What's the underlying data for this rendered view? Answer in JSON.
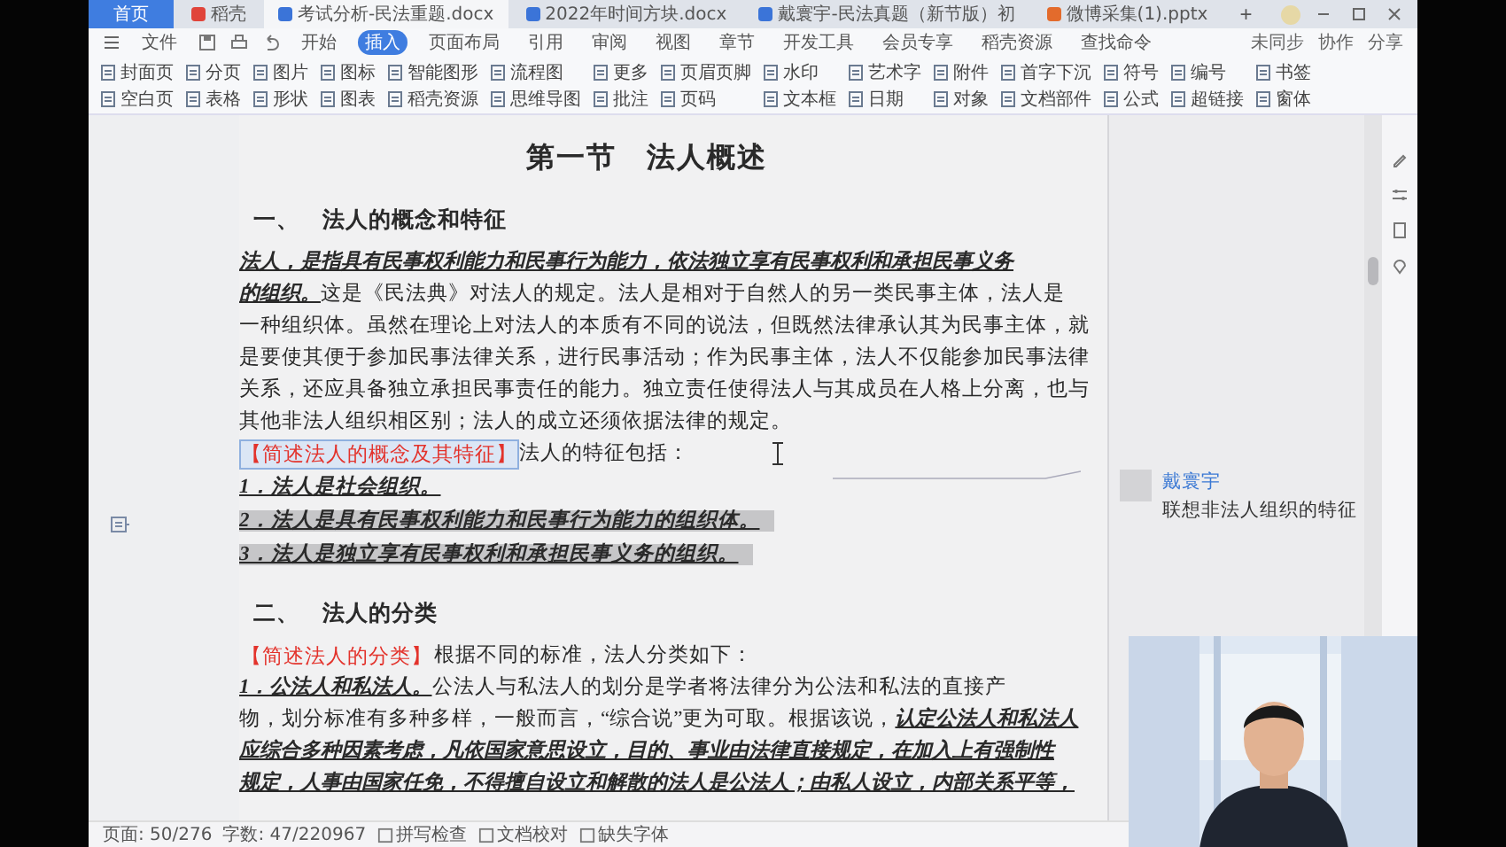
{
  "tabs": [
    {
      "label": "首页",
      "kind": "home",
      "selected": false
    },
    {
      "label": "稻壳",
      "kind": "docer",
      "selected": false
    },
    {
      "label": "考试分析-民法重题.docx",
      "kind": "word",
      "selected": true
    },
    {
      "label": "2022年时间方块.docx",
      "kind": "word",
      "selected": false
    },
    {
      "label": "戴寰宇-民法真题（新节版）初",
      "kind": "word",
      "selected": false
    },
    {
      "label": "微博采集(1).pptx",
      "kind": "ppt",
      "selected": false
    }
  ],
  "new_tab": "+",
  "menu": [
    {
      "label": "文件",
      "selected": false
    },
    {
      "label": "开始",
      "selected": false
    },
    {
      "label": "插入",
      "selected": true
    },
    {
      "label": "页面布局",
      "selected": false
    },
    {
      "label": "引用",
      "selected": false
    },
    {
      "label": "审阅",
      "selected": false
    },
    {
      "label": "视图",
      "selected": false
    },
    {
      "label": "章节",
      "selected": false
    },
    {
      "label": "开发工具",
      "selected": false
    },
    {
      "label": "会员专享",
      "selected": false
    },
    {
      "label": "稻壳资源",
      "selected": false
    },
    {
      "label": "查找命令",
      "selected": false
    }
  ],
  "share": [
    "未同步",
    "协作",
    "分享"
  ],
  "ribbon": [
    "封面页",
    "空白页",
    "分页",
    "表格",
    "图片",
    "形状",
    "图标",
    "图表",
    "智能图形",
    "稻壳资源",
    "流程图",
    "思维导图",
    "更多",
    "批注",
    "页眉页脚",
    "页码",
    "水印",
    "文本框",
    "艺术字",
    "日期",
    "附件",
    "对象",
    "首字下沉",
    "文档部件",
    "符号",
    "公式",
    "编号",
    "超链接",
    "书签",
    "窗体"
  ],
  "doc": {
    "title": "第一节　法人概述",
    "blocks": [
      {
        "kind": "heading",
        "text": "一、　法人的概念和特征"
      },
      {
        "kind": "paragraph",
        "lines": [
          "**法人，是指具有民事权利能力和民事行为能力，依法独立享有民事权利和承担民事义务**",
          "**的组织。**这是《民法典》对法人的规定。法人是相对于自然人的另一类民事主体，法人是",
          "一种组织体。虽然在理论上对法人的本质有不同的说法，但既然法律承认其为民事主体，就",
          "是要使其便于参加民事法律关系，进行民事活动；作为民事主体，法人不仅能参加民事法律",
          "关系，还应具备独立承担民事责任的能力。独立责任使得法人与其成员在人格上分离，也与",
          "其他非法人组织相区别；法人的成立还须依据法律的规定。"
        ]
      },
      {
        "kind": "labeled",
        "label": {
          "text": "【简述法人的概念及其特征】",
          "selected": true
        },
        "text": "法人的特征包括："
      },
      {
        "kind": "list",
        "items": [
          {
            "text": "1．法人是社会组织。",
            "highlighted": false
          },
          {
            "text": "2．法人是具有民事权利能力和民事行为能力的组织体。",
            "highlighted": true
          },
          {
            "text": "3．法人是独立享有民事权利和承担民事义务的组织。",
            "highlighted": true
          }
        ]
      },
      {
        "kind": "heading",
        "text": "二、　法人的分类"
      },
      {
        "kind": "labeled",
        "label": {
          "text": "【简述法人的分类】",
          "selected": false
        },
        "text": "根据不同的标准，法人分类如下："
      },
      {
        "kind": "paragraph",
        "lines": [
          "**1．公法人和私法人。**公法人与私法人的划分是学者将法律分为公法和私法的直接产",
          "物，划分标准有多种多样，一般而言，“综合说”更为可取。根据该说，**认定公法人和私法人**",
          "**应综合多种因素考虑，凡依国家意思设立，目的、事业由法律直接规定，在加入上有强制性**",
          "**规定，人事由国家任免，不得擅自设立和解散的法人是公法人；由私人设立，内部关系平等，**"
        ]
      }
    ]
  },
  "comment": {
    "author": "戴寰宇",
    "text": "联想非法人组织的特征"
  },
  "status_bar": [
    "页面: 50/276",
    "字数: 47/220967",
    "拼写检查",
    "文档校对",
    "缺失字体"
  ]
}
